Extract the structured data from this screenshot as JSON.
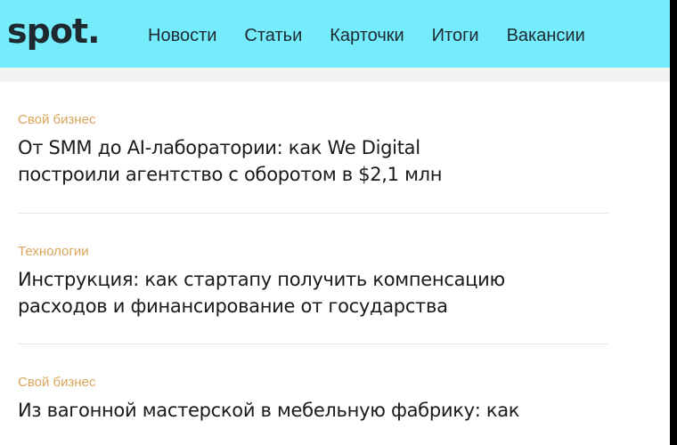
{
  "header": {
    "logo": "spot.",
    "nav": [
      "Новости",
      "Статьи",
      "Карточки",
      "Итоги",
      "Вакансии"
    ]
  },
  "articles": [
    {
      "category": "Свой бизнес",
      "title_line1": "От SMM до AI-лаборатории: как We Digital",
      "title_line2": "построили агентство с оборотом в $2,1 млн"
    },
    {
      "category": "Технологии",
      "title_line1": "Инструкция: как стартапу получить компенсацию",
      "title_line2": "расходов и финансирование от государства"
    },
    {
      "category": "Свой бизнес",
      "title_line1": "Из вагонной мастерской в мебельную фабрику: как",
      "title_line2": ""
    }
  ],
  "colors": {
    "header_bg": "#74ecfb",
    "category": "#d9a65b",
    "text": "#1a1a1a"
  }
}
